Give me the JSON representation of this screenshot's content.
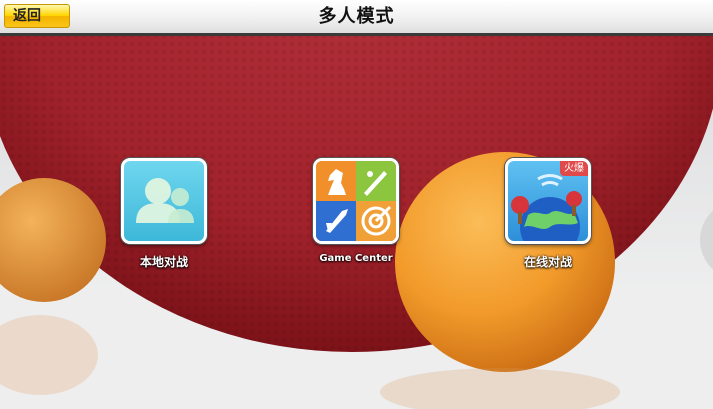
{
  "header": {
    "back_label": "返回",
    "title": "多人模式"
  },
  "modes": [
    {
      "label": "本地对战",
      "icon": "local-players-icon"
    },
    {
      "label": "Game Center",
      "icon": "game-center-icon"
    },
    {
      "label": "在线对战",
      "icon": "online-globe-icon",
      "badge": "火爆"
    }
  ],
  "colors": {
    "paddle_red": "#a3242c",
    "ball_orange": "#f39a2d",
    "back_button_yellow": "#ffd700",
    "tile_local_bg": "#4fc3e0",
    "tile_online_bg": "#3da8e6",
    "badge_red": "#e04a4a"
  }
}
